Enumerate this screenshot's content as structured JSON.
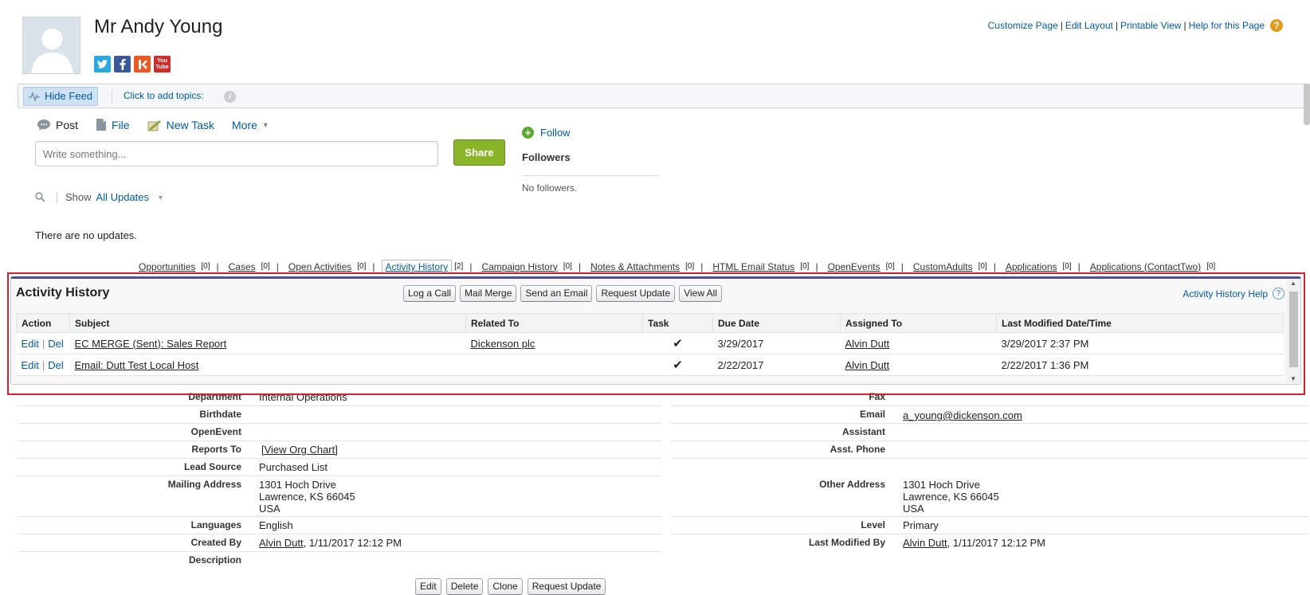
{
  "contact": {
    "name": "Mr Andy Young"
  },
  "social": [
    "twitter-icon",
    "facebook-icon",
    "klout-icon",
    "youtube-icon"
  ],
  "social_labels": {
    "youtube_top": "You",
    "youtube_bottom": "Tube"
  },
  "top_links": {
    "customize": "Customize Page",
    "edit_layout": "Edit Layout",
    "printable": "Printable View",
    "help": "Help for this Page",
    "separator": "|"
  },
  "feed": {
    "hide_feed": "Hide Feed",
    "topics": "Click to add topics:",
    "tabs": {
      "post": "Post",
      "file": "File",
      "new_task": "New Task",
      "more": "More"
    },
    "placeholder": "Write something...",
    "share": "Share",
    "show": "Show",
    "all_updates": "All Updates",
    "no_updates": "There are no updates.",
    "follow": "Follow",
    "followers_title": "Followers",
    "no_followers": "No followers."
  },
  "related_links": [
    {
      "label": "Opportunities",
      "count": "[0]"
    },
    {
      "label": "Cases",
      "count": "[0]"
    },
    {
      "label": "Open Activities",
      "count": "[0]"
    },
    {
      "label": "Activity History",
      "count": "[2]",
      "active": true
    },
    {
      "label": "Campaign History",
      "count": "[0]"
    },
    {
      "label": "Notes & Attachments",
      "count": "[0]"
    },
    {
      "label": "HTML Email Status",
      "count": "[0]"
    },
    {
      "label": "OpenEvents",
      "count": "[0]"
    },
    {
      "label": "CustomAdults",
      "count": "[0]"
    },
    {
      "label": "Applications",
      "count": "[0]"
    },
    {
      "label": "Applications (ContactTwo)",
      "count": "[0]"
    }
  ],
  "activity_history": {
    "title": "Activity History",
    "buttons": {
      "log_call": "Log a Call",
      "mail_merge": "Mail Merge",
      "send_email": "Send an Email",
      "request_update": "Request Update",
      "view_all": "View All"
    },
    "help": "Activity History Help",
    "columns": [
      "Action",
      "Subject",
      "Related To",
      "Task",
      "Due Date",
      "Assigned To",
      "Last Modified Date/Time"
    ],
    "actions": {
      "edit": "Edit",
      "del": "Del",
      "sep": "|"
    },
    "rows": [
      {
        "subject": "EC MERGE (Sent): Sales Report",
        "related_to": "Dickenson plc",
        "task": "✔",
        "due_date": "3/29/2017",
        "assigned_to": "Alvin Dutt",
        "last_modified": "3/29/2017 2:37 PM"
      },
      {
        "subject": "Email: Dutt Test Local Host",
        "related_to": "",
        "task": "✔",
        "due_date": "2/22/2017",
        "assigned_to": "Alvin Dutt",
        "last_modified": "2/22/2017 1:36 PM"
      }
    ]
  },
  "details": {
    "department_label": "Department",
    "department": "Internal Operations",
    "fax_label": "Fax",
    "birthdate_label": "Birthdate",
    "email_label": "Email",
    "email": "a_young@dickenson.com",
    "openevent_label": "OpenEvent",
    "assistant_label": "Assistant",
    "reports_to_label": "Reports To",
    "view_org_chart": "[View Org Chart]",
    "asst_phone_label": "Asst. Phone",
    "lead_source_label": "Lead Source",
    "lead_source": "Purchased List",
    "mailing_label": "Mailing Address",
    "mailing": [
      "1301 Hoch Drive",
      "Lawrence, KS 66045",
      "USA"
    ],
    "other_label": "Other Address",
    "other": [
      "1301 Hoch Drive",
      "Lawrence, KS 66045",
      "USA"
    ],
    "languages_label": "Languages",
    "languages": "English",
    "level_label": "Level",
    "level": "Primary",
    "created_by_label": "Created By",
    "created_by": "Alvin Dutt",
    "created_at": ", 1/11/2017 12:12 PM",
    "last_mod_label": "Last Modified By",
    "last_mod_by": "Alvin Dutt",
    "last_mod_at": ", 1/11/2017 12:12 PM",
    "description_label": "Description"
  },
  "bottom_buttons": {
    "edit": "Edit",
    "delete": "Delete",
    "clone": "Clone",
    "request_update": "Request Update"
  }
}
